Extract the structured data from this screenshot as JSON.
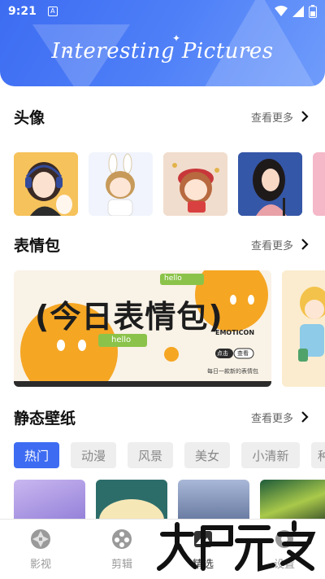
{
  "status_bar": {
    "time": "9:21",
    "a_badge": "A"
  },
  "banner": {
    "title": "Interesting Pictures"
  },
  "sections": {
    "avatars": {
      "title": "头像",
      "more": "查看更多"
    },
    "stickers": {
      "title": "表情包",
      "more": "查看更多",
      "card": {
        "headline": "(今日表情包)",
        "tag": "EMOTICON",
        "hello1": "hello",
        "hello2": "hello",
        "btn_left": "点击",
        "btn_right": "查看",
        "footer": "每日一款新的表情包"
      }
    },
    "wallpapers": {
      "title": "静态壁纸",
      "more": "查看更多",
      "chips": [
        "热门",
        "动漫",
        "风景",
        "美女",
        "小清新",
        "种"
      ]
    }
  },
  "bottom_nav": [
    {
      "label": "影视",
      "icon": "aperture-icon"
    },
    {
      "label": "剪辑",
      "icon": "film-reel-icon"
    },
    {
      "label": "精选",
      "icon": "image-icon"
    },
    {
      "label": "设置",
      "icon": "settings-icon"
    }
  ],
  "colors": {
    "accent": "#3d6cf2",
    "highlight": "#a6f1e0",
    "chip_bg": "#eeeeee"
  }
}
